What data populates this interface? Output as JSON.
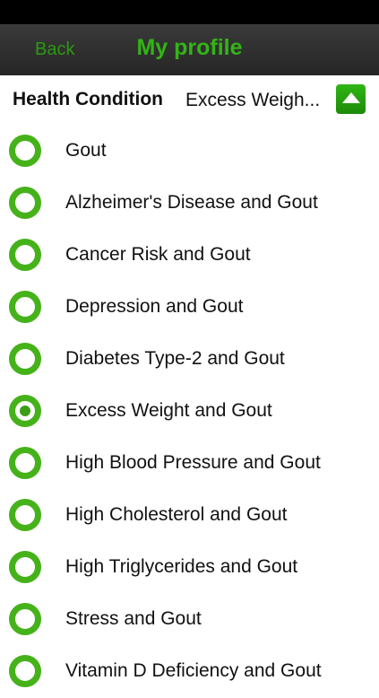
{
  "nav": {
    "back_label": "Back",
    "title": "My profile"
  },
  "condition": {
    "label": "Health Condition",
    "selected_value": "Excess Weigh...",
    "toggle_icon": "triangle-up-icon"
  },
  "options": [
    {
      "label": "Gout",
      "selected": false
    },
    {
      "label": "Alzheimer's Disease and Gout",
      "selected": false
    },
    {
      "label": "Cancer Risk and Gout",
      "selected": false
    },
    {
      "label": "Depression and Gout",
      "selected": false
    },
    {
      "label": "Diabetes Type-2 and Gout",
      "selected": false
    },
    {
      "label": "Excess Weight and Gout",
      "selected": true
    },
    {
      "label": "High Blood Pressure and Gout",
      "selected": false
    },
    {
      "label": "High Cholesterol and Gout",
      "selected": false
    },
    {
      "label": "High Triglycerides and Gout",
      "selected": false
    },
    {
      "label": "Stress and Gout",
      "selected": false
    },
    {
      "label": "Vitamin D Deficiency and Gout",
      "selected": false
    }
  ],
  "colors": {
    "accent_green": "#33b416",
    "radio_green": "#45b21a",
    "nav_background": "#2e2e2e"
  }
}
